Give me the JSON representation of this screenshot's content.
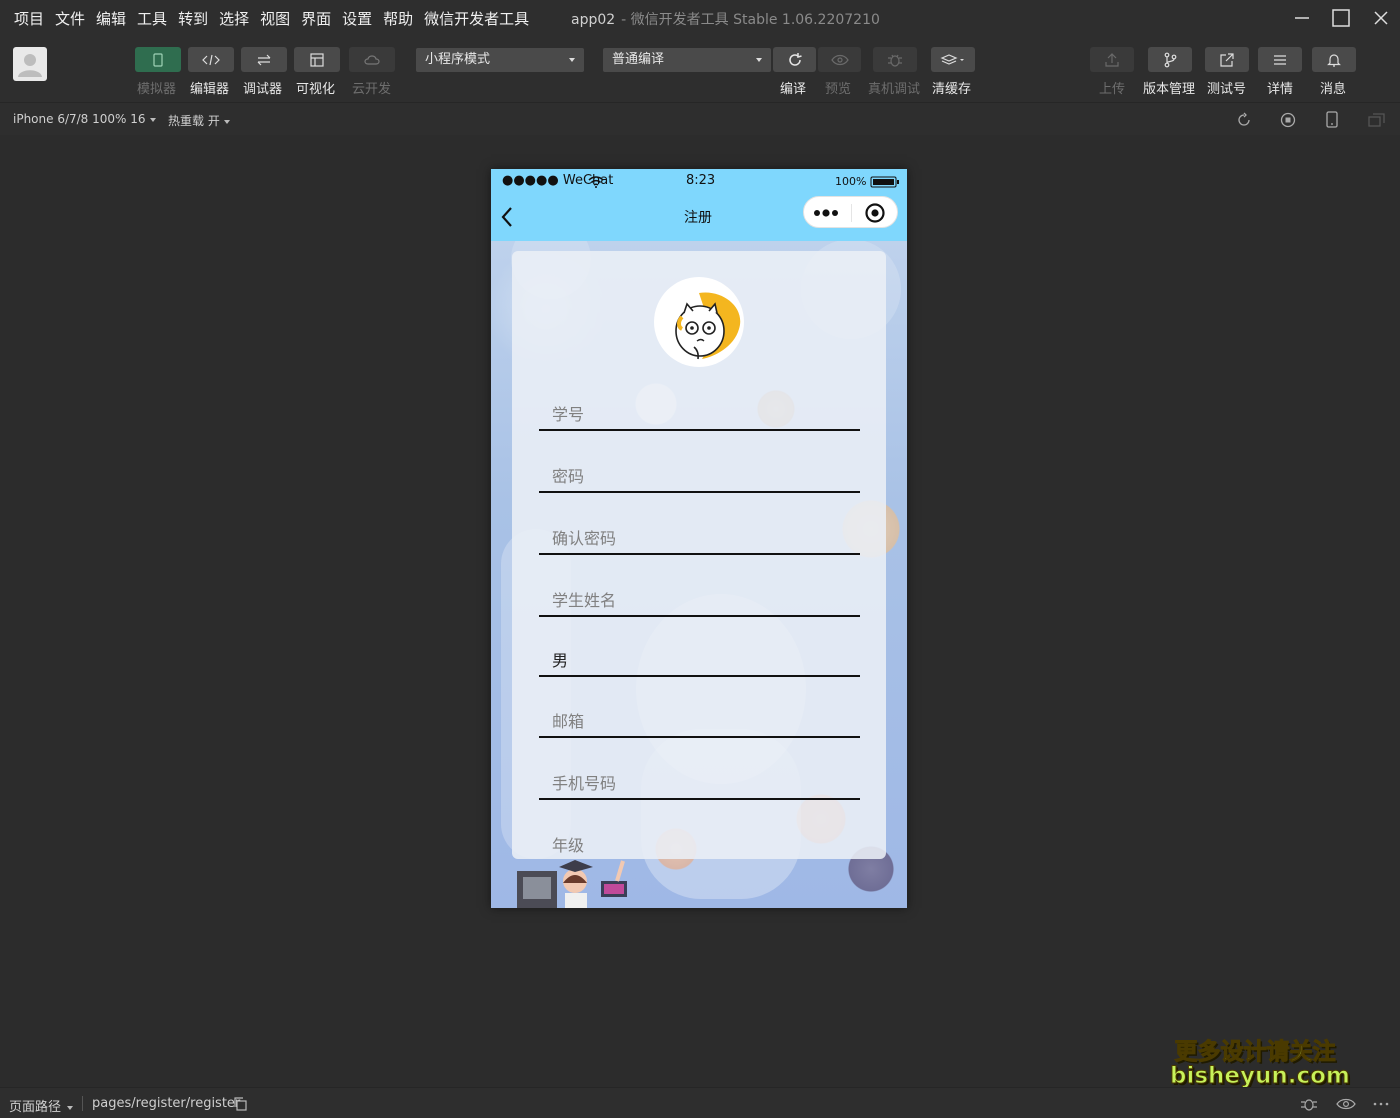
{
  "menu": [
    "项目",
    "文件",
    "编辑",
    "工具",
    "转到",
    "选择",
    "视图",
    "界面",
    "设置",
    "帮助",
    "微信开发者工具"
  ],
  "window": {
    "title": "app02",
    "subtitle": "- 微信开发者工具 Stable 1.06.2207210"
  },
  "toolbar": {
    "simulator": "模拟器",
    "editor": "编辑器",
    "debugger": "调试器",
    "visual": "可视化",
    "cloud": "云开发",
    "mode_select": "小程序模式",
    "compile_select": "普通编译",
    "compile": "编译",
    "preview": "预览",
    "real_debug": "真机调试",
    "clear_cache": "清缓存",
    "upload": "上传",
    "version": "版本管理",
    "test_account": "测试号",
    "details": "详情",
    "messages": "消息"
  },
  "subbar": {
    "device": "iPhone 6/7/8 100% 16",
    "hot_reload": "热重载 开"
  },
  "phone": {
    "carrier": "●●●●● WeChat",
    "time": "8:23",
    "battery": "100%",
    "nav_title": "注册"
  },
  "form": {
    "fields": [
      {
        "text": "学号",
        "filled": false
      },
      {
        "text": "密码",
        "filled": false
      },
      {
        "text": "确认密码",
        "filled": false
      },
      {
        "text": "学生姓名",
        "filled": false
      },
      {
        "text": "男",
        "filled": true
      },
      {
        "text": "邮箱",
        "filled": false
      },
      {
        "text": "手机号码",
        "filled": false
      },
      {
        "text": "年级",
        "filled": false
      }
    ]
  },
  "bottombar": {
    "page_path_label": "页面路径",
    "path": "pages/register/register"
  },
  "watermark": {
    "line1": "更多设计请关注",
    "line2": "bisheyun.com"
  },
  "colors": {
    "nav_bg": "#7fd7fd",
    "toolbar_bg": "#2e2e2e",
    "active_btn": "#2f6d4f"
  }
}
